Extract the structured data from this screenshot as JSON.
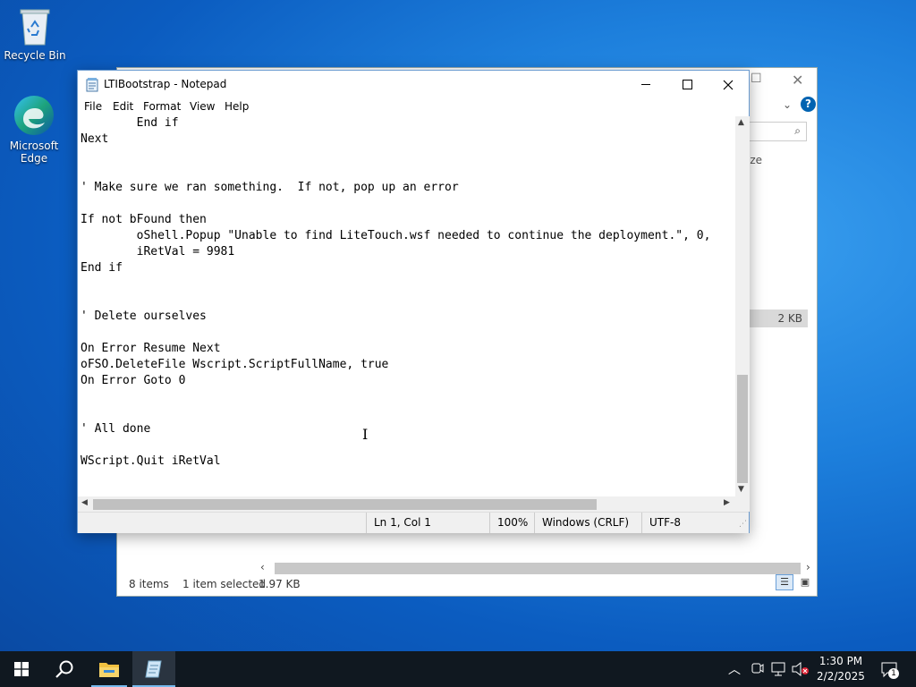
{
  "desktop": {
    "icons": [
      {
        "label": "Recycle Bin"
      },
      {
        "label": "Microsoft Edge"
      }
    ]
  },
  "explorer": {
    "column_header": "ize",
    "selected_size": "2 KB",
    "status": {
      "items": "8 items",
      "selected": "1 item selected",
      "size": "1.97 KB"
    }
  },
  "notepad": {
    "title": "LTIBootstrap - Notepad",
    "menu": [
      "File",
      "Edit",
      "Format",
      "View",
      "Help"
    ],
    "content": "        End if\nNext\n\n\n' Make sure we ran something.  If not, pop up an error\n\nIf not bFound then\n        oShell.Popup \"Unable to find LiteTouch.wsf needed to continue the deployment.\", 0,\n        iRetVal = 9981\nEnd if\n\n\n' Delete ourselves\n\nOn Error Resume Next\noFSO.DeleteFile Wscript.ScriptFullName, true\nOn Error Goto 0\n\n\n' All done\n\nWScript.Quit iRetVal",
    "status": {
      "position": "Ln 1, Col 1",
      "zoom": "100%",
      "line_ending": "Windows (CRLF)",
      "encoding": "UTF-8"
    },
    "scroll": {
      "vertical_fraction": 0.72,
      "horizontal_fraction": 0.0
    }
  },
  "taskbar": {
    "clock": {
      "time": "1:30 PM",
      "date": "2/2/2025"
    },
    "notification_count": "1",
    "icons": [
      "start-icon",
      "search-icon",
      "file-explorer-icon",
      "notepad-icon"
    ],
    "tray_icons": [
      "chevron-up-icon",
      "meet-now-icon",
      "network-icon",
      "volume-muted-icon",
      "notification-icon"
    ]
  },
  "colors": {
    "taskbar": "#101820",
    "desktop": "#1d7fdc",
    "accent": "#0078d7"
  }
}
